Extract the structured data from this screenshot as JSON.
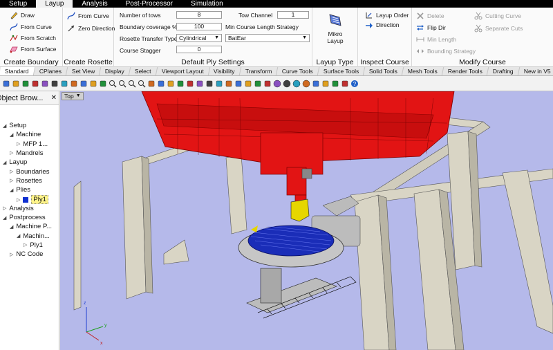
{
  "menu": [
    "Setup",
    "Layup",
    "Analysis",
    "Post-Processor",
    "Simulation"
  ],
  "ribbon": {
    "create_boundary": {
      "title": "Create Boundary",
      "items": [
        "Draw",
        "From Curve",
        "From Scratch",
        "From Surface"
      ]
    },
    "create_rosette": {
      "title": "Create Rosette",
      "items": [
        "From Curve",
        "Zero Direction"
      ]
    },
    "ply_settings": {
      "title": "Default Ply Settings",
      "num_tows_label": "Number of tows",
      "num_tows": "8",
      "coverage_label": "Boundary coverage %",
      "coverage": "100",
      "rosette_label": "Rosette Transfer Type",
      "rosette_value": "Cylindrical",
      "stagger_label": "Course Stagger",
      "stagger": "0",
      "tow_channel_label": "Tow Channel",
      "tow_channel": "1",
      "min_course_label": "Min Course Length Strategy",
      "min_course_value": "BatEar"
    },
    "layup_type": {
      "title": "Layup Type",
      "button": "Mikro\nLayup",
      "line1": "Mikro",
      "line2": "Layup"
    },
    "inspect_course": {
      "title": "Inspect Course",
      "items": [
        "Layup Order",
        "Direction"
      ]
    },
    "modify_course": {
      "title": "Modify Course",
      "left": [
        "Delete",
        "Flip Dir",
        "Min Length",
        "Bounding Strategy"
      ],
      "right": [
        "Cutting Curve",
        "Separate Cuts"
      ]
    }
  },
  "tabs": [
    "Standard",
    "CPlanes",
    "Set View",
    "Display",
    "Select",
    "Viewport Layout",
    "Visibility",
    "Transform",
    "Curve Tools",
    "Surface Tools",
    "Solid Tools",
    "Mesh Tools",
    "Render Tools",
    "Drafting",
    "New in V5"
  ],
  "toolbar_icons": [
    "new-icon",
    "open-icon",
    "save-icon",
    "print-icon",
    "import-icon",
    "cut-icon",
    "copy-icon",
    "paste-icon",
    "undo-icon",
    "pan-hand-icon",
    "rotate-icon",
    "zoom-window-icon",
    "zoom-icon",
    "zoom-extents-icon",
    "zoom-selected-icon",
    "undo-view-icon",
    "grid-icon",
    "points-icon",
    "curve-icon",
    "car-icon",
    "mesh-icon",
    "ellipse-icon",
    "layer-icon",
    "light-icon",
    "lock-icon",
    "color-icon",
    "material-icon",
    "render-icon",
    "wire-sphere-icon",
    "shaded-sphere-icon",
    "ghost-sphere-icon",
    "xray-sphere-icon",
    "bulb-icon",
    "tool-icon",
    "shield-icon",
    "fan-icon",
    "help-icon"
  ],
  "panel": {
    "title": "Object Brow...",
    "tree": [
      {
        "label": "Setup",
        "level": 0,
        "open": true
      },
      {
        "label": "Machine",
        "level": 1,
        "open": true
      },
      {
        "label": "MFP 1...",
        "level": 2,
        "open": false
      },
      {
        "label": "Mandrels",
        "level": 1,
        "open": false
      },
      {
        "label": "Layup",
        "level": 0,
        "open": true
      },
      {
        "label": "Boundaries",
        "level": 1,
        "open": false
      },
      {
        "label": "Rosettes",
        "level": 1,
        "open": false
      },
      {
        "label": "Plies",
        "level": 1,
        "open": true
      },
      {
        "label": "Ply1",
        "level": 2,
        "open": false,
        "selected": true
      },
      {
        "label": "Analysis",
        "level": 0,
        "open": false
      },
      {
        "label": "Postprocess",
        "level": 0,
        "open": true
      },
      {
        "label": "Machine P...",
        "level": 1,
        "open": true
      },
      {
        "label": "Machin...",
        "level": 2,
        "open": true
      },
      {
        "label": "Ply1",
        "level": 3,
        "open": false
      },
      {
        "label": "NC Code",
        "level": 1,
        "open": false
      }
    ]
  },
  "viewport": {
    "name": "Top",
    "axes": {
      "x": "x",
      "y": "y",
      "z": "z"
    }
  },
  "colors": {
    "gantry": "#e01010",
    "column": "#d8d4c4",
    "viewport_bg": "#b5b9ea",
    "ply": "#1a2db8",
    "head": "#e6d600"
  }
}
